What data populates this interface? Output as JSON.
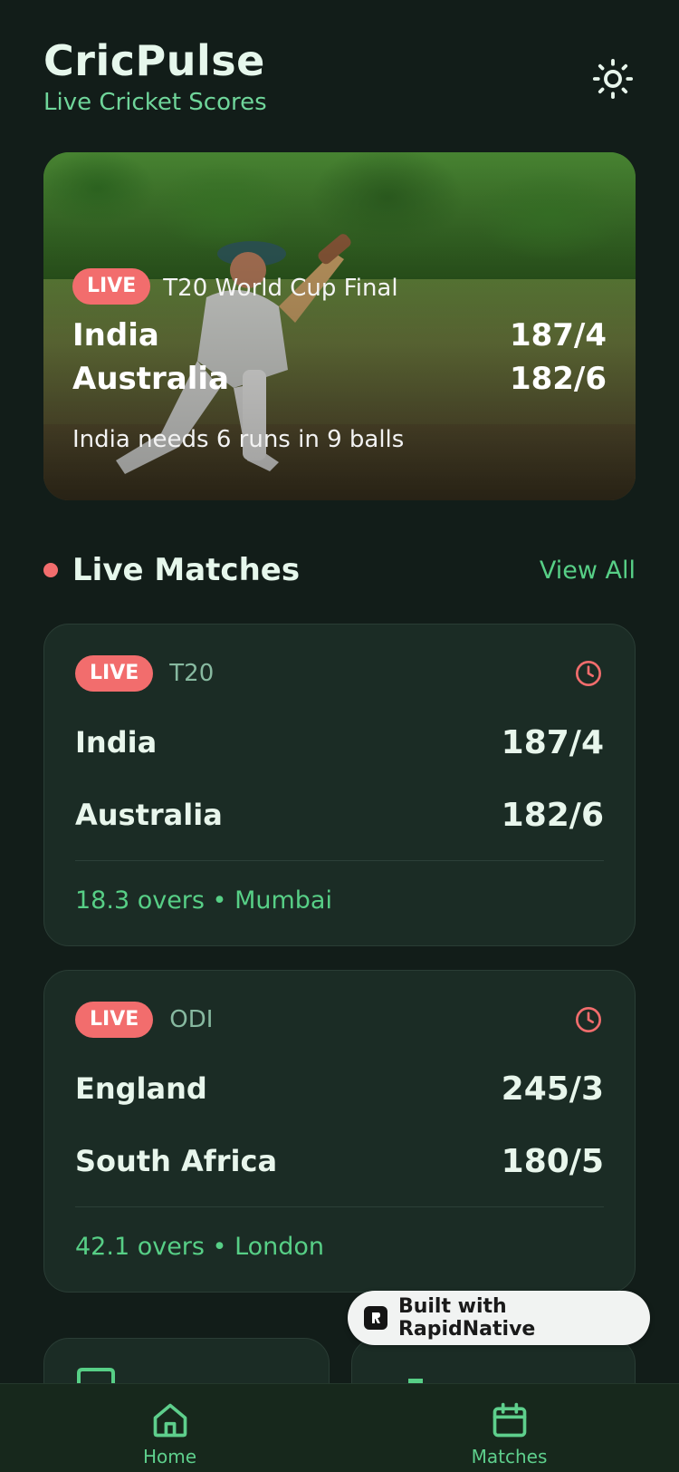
{
  "header": {
    "title": "CricPulse",
    "subtitle": "Live Cricket Scores",
    "theme_icon": "sun-icon"
  },
  "featured": {
    "badge": "LIVE",
    "league": "T20 World Cup Final",
    "teams": [
      {
        "name": "India",
        "score": "187/4"
      },
      {
        "name": "Australia",
        "score": "182/6"
      }
    ],
    "status": "India needs 6 runs in 9 balls"
  },
  "live_section": {
    "title": "Live Matches",
    "view_all": "View All"
  },
  "matches": [
    {
      "badge": "LIVE",
      "format": "T20",
      "teams": [
        {
          "name": "India",
          "score": "187/4"
        },
        {
          "name": "Australia",
          "score": "182/6"
        }
      ],
      "footer": "18.3 overs • Mumbai"
    },
    {
      "badge": "LIVE",
      "format": "ODI",
      "teams": [
        {
          "name": "England",
          "score": "245/3"
        },
        {
          "name": "South Africa",
          "score": "180/5"
        }
      ],
      "footer": "42.1 overs • London"
    }
  ],
  "built_with": "Built with RapidNative",
  "nav": {
    "items": [
      {
        "label": "Home",
        "icon": "home-icon"
      },
      {
        "label": "Matches",
        "icon": "calendar-icon"
      }
    ]
  },
  "colors": {
    "background": "#121d19",
    "accent": "#57cf86",
    "live": "#f26d6d",
    "card": "#1b2c25"
  }
}
